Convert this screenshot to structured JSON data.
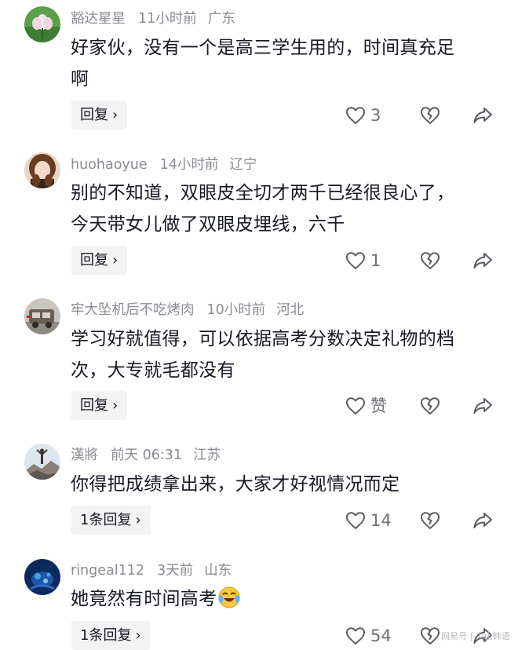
{
  "comments": [
    {
      "username": "豁达星星",
      "time": "11小时前",
      "location": "广东",
      "lines": [
        "好家伙，没有一个是高三学生用的，时间真充足",
        "啊"
      ],
      "reply_label": "回复",
      "likes": "3",
      "avatar": "flower-avatar"
    },
    {
      "username": "huohaoyue",
      "time": "14小时前",
      "location": "辽宁",
      "lines": [
        "别的不知道，双眼皮全切才两千已经很良心了，",
        "今天带女儿做了双眼皮埋线，六千"
      ],
      "reply_label": "回复",
      "likes": "1",
      "avatar": "girl-avatar"
    },
    {
      "username": "牢大坠机后不吃烤肉",
      "time": "10小时前",
      "location": "河北",
      "lines": [
        "学习好就值得，可以依据高考分数决定礼物的档",
        "次，大专就毛都没有"
      ],
      "reply_label": "回复",
      "likes": "赞",
      "avatar": "vehicle-avatar"
    },
    {
      "username": "漢將",
      "time": "前天 06:31",
      "location": "江苏",
      "lines": [
        "你得把成绩拿出来，大家才好视情况而定"
      ],
      "reply_label": "1条回复",
      "likes": "14",
      "avatar": "mountain-avatar"
    },
    {
      "username": "ringeal112",
      "time": "3天前",
      "location": "山东",
      "lines": [
        "她竟然有时间高考"
      ],
      "reply_label": "1条回复",
      "likes": "54",
      "avatar": "ocean-avatar"
    }
  ],
  "icons": {
    "like": "heart-outline-icon",
    "dislike": "broken-heart-icon",
    "share": "share-arrow-icon",
    "reply_chevron": "chevron-right-icon",
    "emoji": "crying-laughing-emoji"
  },
  "colors": {
    "text": "#161823",
    "meta": "#8a8b91",
    "reply_bg": "#f3f3f4",
    "icon": "#5b5c63"
  },
  "watermark": "网易号 | 火山韩语"
}
